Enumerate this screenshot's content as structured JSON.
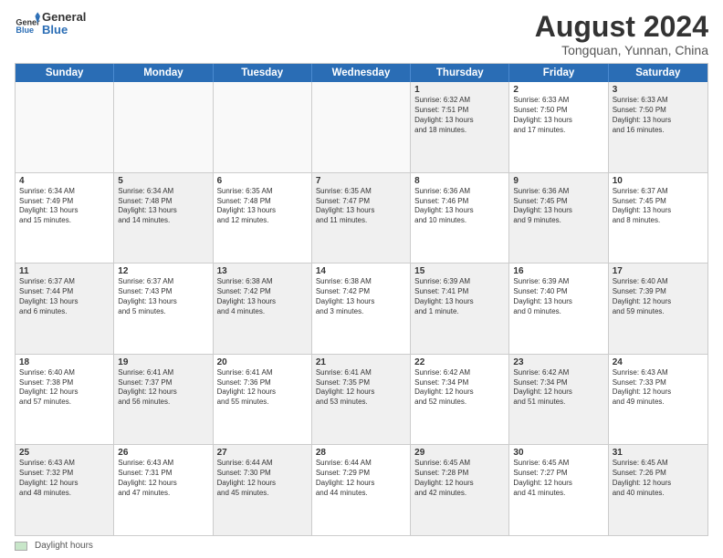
{
  "header": {
    "logo_general": "General",
    "logo_blue": "Blue",
    "main_title": "August 2024",
    "subtitle": "Tongquan, Yunnan, China"
  },
  "calendar": {
    "days_of_week": [
      "Sunday",
      "Monday",
      "Tuesday",
      "Wednesday",
      "Thursday",
      "Friday",
      "Saturday"
    ],
    "weeks": [
      [
        {
          "num": "",
          "info": "",
          "empty": true
        },
        {
          "num": "",
          "info": "",
          "empty": true
        },
        {
          "num": "",
          "info": "",
          "empty": true
        },
        {
          "num": "",
          "info": "",
          "empty": true
        },
        {
          "num": "1",
          "info": "Sunrise: 6:32 AM\nSunset: 7:51 PM\nDaylight: 13 hours\nand 18 minutes.",
          "shaded": true
        },
        {
          "num": "2",
          "info": "Sunrise: 6:33 AM\nSunset: 7:50 PM\nDaylight: 13 hours\nand 17 minutes.",
          "shaded": false
        },
        {
          "num": "3",
          "info": "Sunrise: 6:33 AM\nSunset: 7:50 PM\nDaylight: 13 hours\nand 16 minutes.",
          "shaded": true
        }
      ],
      [
        {
          "num": "4",
          "info": "Sunrise: 6:34 AM\nSunset: 7:49 PM\nDaylight: 13 hours\nand 15 minutes.",
          "shaded": false
        },
        {
          "num": "5",
          "info": "Sunrise: 6:34 AM\nSunset: 7:48 PM\nDaylight: 13 hours\nand 14 minutes.",
          "shaded": true
        },
        {
          "num": "6",
          "info": "Sunrise: 6:35 AM\nSunset: 7:48 PM\nDaylight: 13 hours\nand 12 minutes.",
          "shaded": false
        },
        {
          "num": "7",
          "info": "Sunrise: 6:35 AM\nSunset: 7:47 PM\nDaylight: 13 hours\nand 11 minutes.",
          "shaded": true
        },
        {
          "num": "8",
          "info": "Sunrise: 6:36 AM\nSunset: 7:46 PM\nDaylight: 13 hours\nand 10 minutes.",
          "shaded": false
        },
        {
          "num": "9",
          "info": "Sunrise: 6:36 AM\nSunset: 7:45 PM\nDaylight: 13 hours\nand 9 minutes.",
          "shaded": true
        },
        {
          "num": "10",
          "info": "Sunrise: 6:37 AM\nSunset: 7:45 PM\nDaylight: 13 hours\nand 8 minutes.",
          "shaded": false
        }
      ],
      [
        {
          "num": "11",
          "info": "Sunrise: 6:37 AM\nSunset: 7:44 PM\nDaylight: 13 hours\nand 6 minutes.",
          "shaded": true
        },
        {
          "num": "12",
          "info": "Sunrise: 6:37 AM\nSunset: 7:43 PM\nDaylight: 13 hours\nand 5 minutes.",
          "shaded": false
        },
        {
          "num": "13",
          "info": "Sunrise: 6:38 AM\nSunset: 7:42 PM\nDaylight: 13 hours\nand 4 minutes.",
          "shaded": true
        },
        {
          "num": "14",
          "info": "Sunrise: 6:38 AM\nSunset: 7:42 PM\nDaylight: 13 hours\nand 3 minutes.",
          "shaded": false
        },
        {
          "num": "15",
          "info": "Sunrise: 6:39 AM\nSunset: 7:41 PM\nDaylight: 13 hours\nand 1 minute.",
          "shaded": true
        },
        {
          "num": "16",
          "info": "Sunrise: 6:39 AM\nSunset: 7:40 PM\nDaylight: 13 hours\nand 0 minutes.",
          "shaded": false
        },
        {
          "num": "17",
          "info": "Sunrise: 6:40 AM\nSunset: 7:39 PM\nDaylight: 12 hours\nand 59 minutes.",
          "shaded": true
        }
      ],
      [
        {
          "num": "18",
          "info": "Sunrise: 6:40 AM\nSunset: 7:38 PM\nDaylight: 12 hours\nand 57 minutes.",
          "shaded": false
        },
        {
          "num": "19",
          "info": "Sunrise: 6:41 AM\nSunset: 7:37 PM\nDaylight: 12 hours\nand 56 minutes.",
          "shaded": true
        },
        {
          "num": "20",
          "info": "Sunrise: 6:41 AM\nSunset: 7:36 PM\nDaylight: 12 hours\nand 55 minutes.",
          "shaded": false
        },
        {
          "num": "21",
          "info": "Sunrise: 6:41 AM\nSunset: 7:35 PM\nDaylight: 12 hours\nand 53 minutes.",
          "shaded": true
        },
        {
          "num": "22",
          "info": "Sunrise: 6:42 AM\nSunset: 7:34 PM\nDaylight: 12 hours\nand 52 minutes.",
          "shaded": false
        },
        {
          "num": "23",
          "info": "Sunrise: 6:42 AM\nSunset: 7:34 PM\nDaylight: 12 hours\nand 51 minutes.",
          "shaded": true
        },
        {
          "num": "24",
          "info": "Sunrise: 6:43 AM\nSunset: 7:33 PM\nDaylight: 12 hours\nand 49 minutes.",
          "shaded": false
        }
      ],
      [
        {
          "num": "25",
          "info": "Sunrise: 6:43 AM\nSunset: 7:32 PM\nDaylight: 12 hours\nand 48 minutes.",
          "shaded": true
        },
        {
          "num": "26",
          "info": "Sunrise: 6:43 AM\nSunset: 7:31 PM\nDaylight: 12 hours\nand 47 minutes.",
          "shaded": false
        },
        {
          "num": "27",
          "info": "Sunrise: 6:44 AM\nSunset: 7:30 PM\nDaylight: 12 hours\nand 45 minutes.",
          "shaded": true
        },
        {
          "num": "28",
          "info": "Sunrise: 6:44 AM\nSunset: 7:29 PM\nDaylight: 12 hours\nand 44 minutes.",
          "shaded": false
        },
        {
          "num": "29",
          "info": "Sunrise: 6:45 AM\nSunset: 7:28 PM\nDaylight: 12 hours\nand 42 minutes.",
          "shaded": true
        },
        {
          "num": "30",
          "info": "Sunrise: 6:45 AM\nSunset: 7:27 PM\nDaylight: 12 hours\nand 41 minutes.",
          "shaded": false
        },
        {
          "num": "31",
          "info": "Sunrise: 6:45 AM\nSunset: 7:26 PM\nDaylight: 12 hours\nand 40 minutes.",
          "shaded": true
        }
      ]
    ]
  },
  "footer": {
    "legend_label": "Daylight hours"
  }
}
